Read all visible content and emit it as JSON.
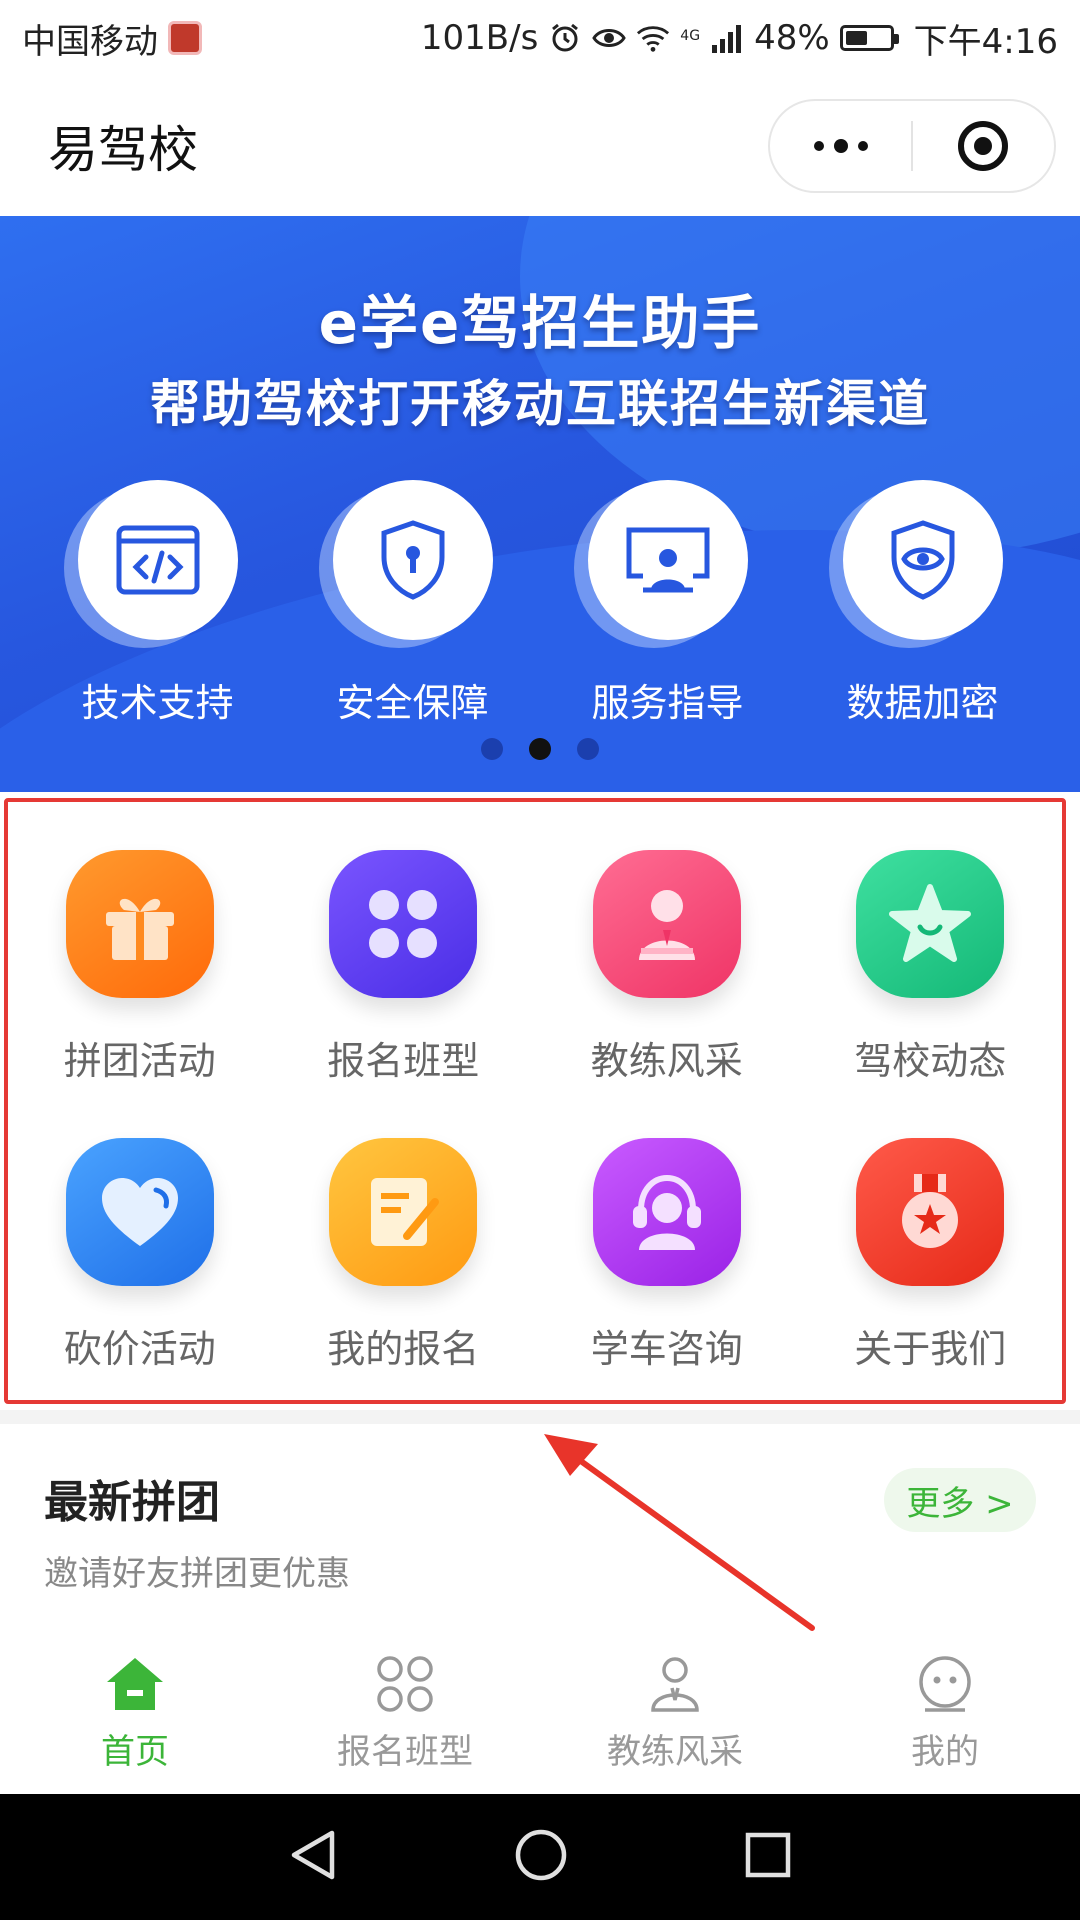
{
  "status_bar": {
    "carrier": "中国移动",
    "speed": "101B/s",
    "network": "4G",
    "battery": "48%",
    "battery_level": 0.48,
    "time": "下午4:16"
  },
  "nav": {
    "title": "易驾校"
  },
  "banner": {
    "title": "e学e驾招生助手",
    "subtitle": "帮助驾校打开移动互联招生新渠道",
    "features": [
      {
        "label": "技术支持",
        "icon": "code-window-icon"
      },
      {
        "label": "安全保障",
        "icon": "shield-lock-icon"
      },
      {
        "label": "服务指导",
        "icon": "presentation-icon"
      },
      {
        "label": "数据加密",
        "icon": "encrypted-shield-icon"
      }
    ],
    "active_slide": 1,
    "slide_count": 3
  },
  "menu": {
    "items": [
      {
        "label": "拼团活动",
        "icon": "gift-icon",
        "color": "#ff7a1a"
      },
      {
        "label": "报名班型",
        "icon": "clover-icon",
        "color": "#5a3df0"
      },
      {
        "label": "教练风采",
        "icon": "coach-icon",
        "color": "#f2467a"
      },
      {
        "label": "驾校动态",
        "icon": "star-icon",
        "color": "#21c98a"
      },
      {
        "label": "砍价活动",
        "icon": "heart-icon",
        "color": "#2f86f5"
      },
      {
        "label": "我的报名",
        "icon": "form-edit-icon",
        "color": "#ffaf1f"
      },
      {
        "label": "学车咨询",
        "icon": "headset-icon",
        "color": "#b03cf0"
      },
      {
        "label": "关于我们",
        "icon": "medal-icon",
        "color": "#ff3b2f"
      }
    ]
  },
  "latest": {
    "title": "最新拼团",
    "subtitle": "邀请好友拼团更优惠",
    "more": "更多 >"
  },
  "tabs": [
    {
      "label": "首页",
      "icon": "home-icon",
      "active": true
    },
    {
      "label": "报名班型",
      "icon": "clover-icon",
      "active": false
    },
    {
      "label": "教练风采",
      "icon": "coach-icon",
      "active": false
    },
    {
      "label": "我的",
      "icon": "face-icon",
      "active": false
    }
  ],
  "colors": {
    "accent_green": "#3cb539",
    "banner_blue": "#2757df",
    "highlight_red": "#e53935"
  }
}
